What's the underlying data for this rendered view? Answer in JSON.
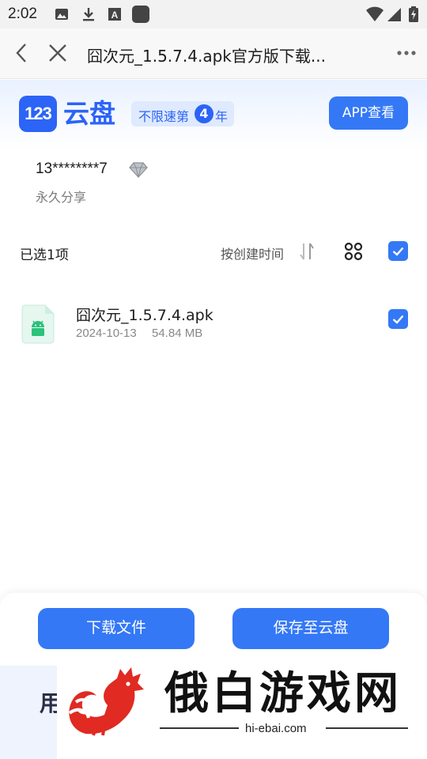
{
  "status_bar": {
    "time": "2:02",
    "icons": [
      "image-icon",
      "download-icon",
      "font-a-icon",
      "app-square-icon",
      "wifi-icon",
      "signal-icon",
      "battery-charging-icon"
    ]
  },
  "nav": {
    "title": "囧次元_1.5.7.4.apk官方版下载...",
    "icons": [
      "back-arrow-icon",
      "close-icon",
      "more-icon"
    ]
  },
  "brand": {
    "logo_number": "123",
    "logo_text": "云盘",
    "badge_prefix": "不限速第",
    "badge_number": "4",
    "badge_suffix": "年",
    "app_button": "APP查看",
    "accent_color": "#3478f6"
  },
  "share": {
    "user": "13********7",
    "type": "永久分享"
  },
  "toolbar": {
    "selected_label": "已选1项",
    "sort_label": "按创建时间"
  },
  "files": [
    {
      "name": "囧次元_1.5.7.4.apk",
      "date": "2024-10-13",
      "size": "54.84 MB",
      "checked": true
    }
  ],
  "actions": {
    "download": "下载文件",
    "save": "保存至云盘"
  },
  "under_text": "用",
  "watermark": {
    "title": "俄白游戏网",
    "url": "hi-ebai.com"
  }
}
